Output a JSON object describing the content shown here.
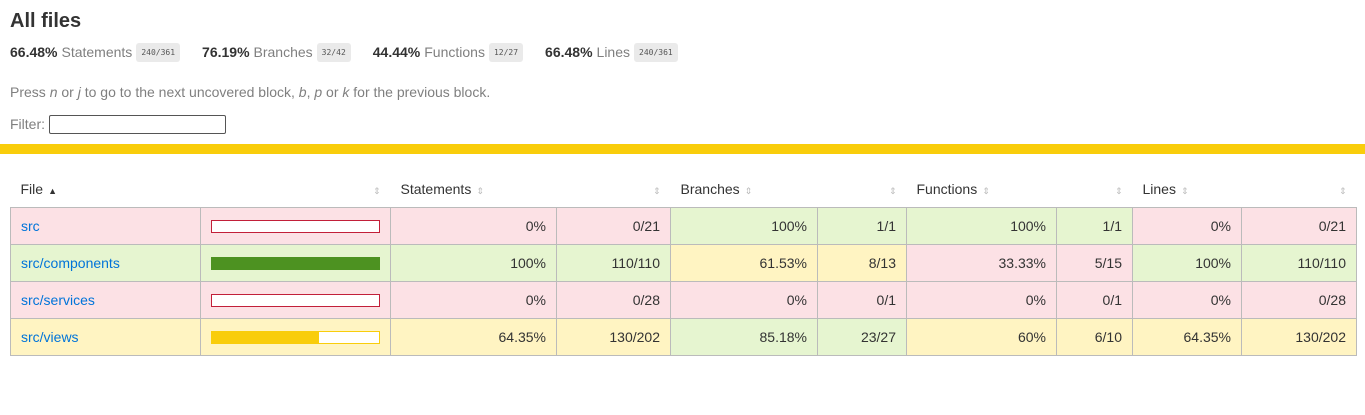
{
  "title": "All files",
  "summary": [
    {
      "pct": "66.48%",
      "label": "Statements",
      "frac": "240/361"
    },
    {
      "pct": "76.19%",
      "label": "Branches",
      "frac": "32/42"
    },
    {
      "pct": "44.44%",
      "label": "Functions",
      "frac": "12/27"
    },
    {
      "pct": "66.48%",
      "label": "Lines",
      "frac": "240/361"
    }
  ],
  "hint": {
    "t1": "Press ",
    "k1": "n",
    "t2": " or ",
    "k2": "j",
    "t3": " to go to the next uncovered block, ",
    "k3": "b",
    "t4": ", ",
    "k4": "p",
    "t5": " or ",
    "k5": "k",
    "t6": " for the previous block."
  },
  "filter": {
    "label": "Filter:",
    "value": ""
  },
  "colors": {
    "low": "#fce1e5",
    "medium": "#fff4c2",
    "high": "#e6f5d0",
    "link": "#0074d9",
    "status_line": "#f9cd0b"
  },
  "table": {
    "headers": {
      "file": "File",
      "file_sort": "▲",
      "sort_icon": "⇕",
      "statements": "Statements",
      "branches": "Branches",
      "functions": "Functions",
      "lines": "Lines"
    },
    "rows": [
      {
        "file": "src",
        "coverage": 0,
        "level": "low",
        "st_pct": "0%",
        "st_frac": "0/21",
        "st_lvl": "low",
        "br_pct": "100%",
        "br_frac": "1/1",
        "br_lvl": "high",
        "fn_pct": "100%",
        "fn_frac": "1/1",
        "fn_lvl": "high",
        "ln_pct": "0%",
        "ln_frac": "0/21",
        "ln_lvl": "low"
      },
      {
        "file": "src/components",
        "coverage": 100,
        "level": "high",
        "st_pct": "100%",
        "st_frac": "110/110",
        "st_lvl": "high",
        "br_pct": "61.53%",
        "br_frac": "8/13",
        "br_lvl": "medium",
        "fn_pct": "33.33%",
        "fn_frac": "5/15",
        "fn_lvl": "low",
        "ln_pct": "100%",
        "ln_frac": "110/110",
        "ln_lvl": "high"
      },
      {
        "file": "src/services",
        "coverage": 0,
        "level": "low",
        "st_pct": "0%",
        "st_frac": "0/28",
        "st_lvl": "low",
        "br_pct": "0%",
        "br_frac": "0/1",
        "br_lvl": "low",
        "fn_pct": "0%",
        "fn_frac": "0/1",
        "fn_lvl": "low",
        "ln_pct": "0%",
        "ln_frac": "0/28",
        "ln_lvl": "low"
      },
      {
        "file": "src/views",
        "coverage": 64.35,
        "level": "medium",
        "st_pct": "64.35%",
        "st_frac": "130/202",
        "st_lvl": "medium",
        "br_pct": "85.18%",
        "br_frac": "23/27",
        "br_lvl": "high",
        "fn_pct": "60%",
        "fn_frac": "6/10",
        "fn_lvl": "medium",
        "ln_pct": "64.35%",
        "ln_frac": "130/202",
        "ln_lvl": "medium"
      }
    ]
  }
}
